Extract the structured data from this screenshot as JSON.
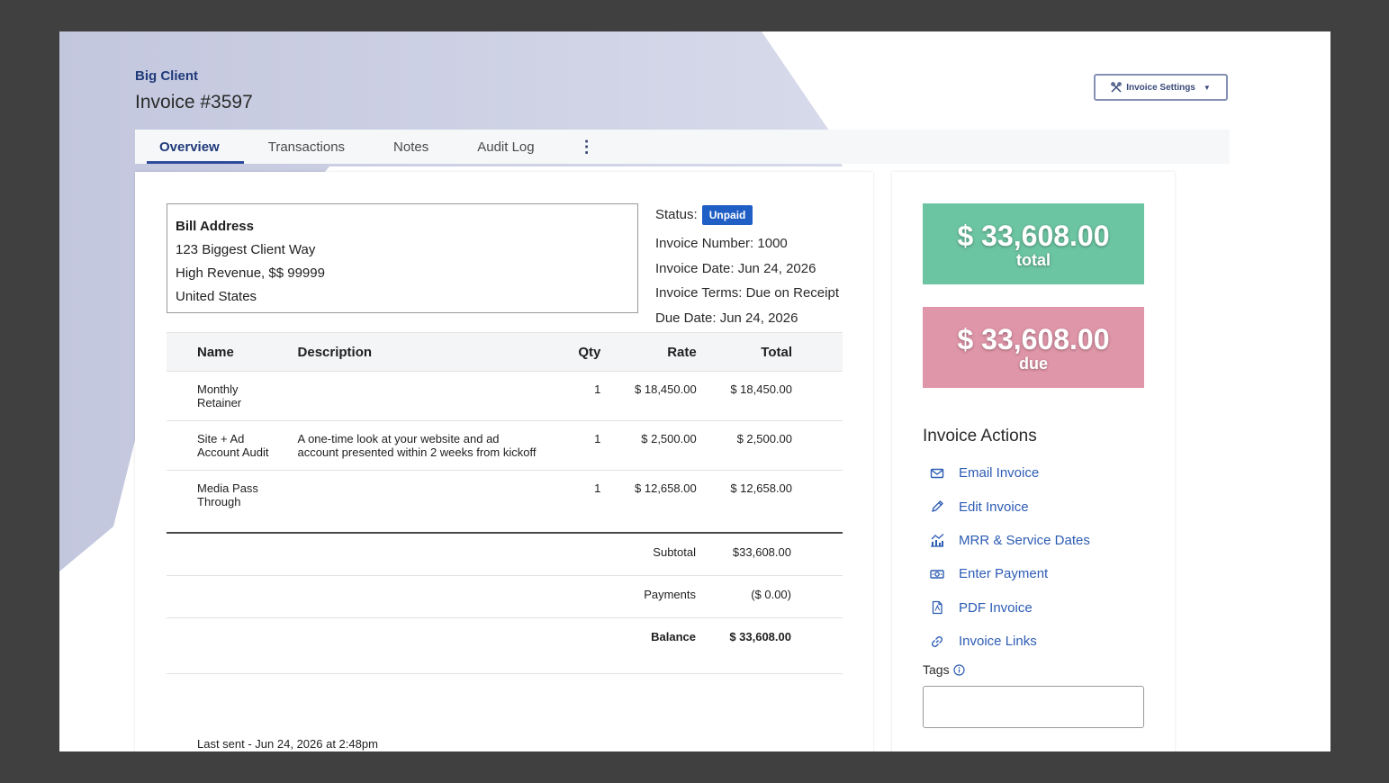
{
  "header": {
    "client_name": "Big Client",
    "invoice_title": "Invoice #3597",
    "settings_label": "Invoice Settings"
  },
  "tabs": [
    {
      "label": "Overview",
      "active": true
    },
    {
      "label": "Transactions"
    },
    {
      "label": "Notes"
    },
    {
      "label": "Audit Log"
    }
  ],
  "tabs_more": "⋮",
  "address": {
    "title": "Bill Address",
    "line1": "123 Biggest Client Way",
    "line2": "High Revenue, $$ 99999",
    "line3": "United States"
  },
  "status": {
    "label": "Status:",
    "badge": "Unpaid",
    "invoice_number": "Invoice Number: 1000",
    "invoice_date": "Invoice Date: Jun 24, 2026",
    "invoice_terms": "Invoice Terms: Due on Receipt",
    "due_date": "Due Date: Jun 24, 2026"
  },
  "table": {
    "headers": {
      "name": "Name",
      "description": "Description",
      "qty": "Qty",
      "rate": "Rate",
      "total": "Total"
    },
    "rows": [
      {
        "name_1": "Monthly",
        "name_2": "Retainer",
        "desc_1": "",
        "desc_2": "",
        "qty": "1",
        "rate": "$ 18,450.00",
        "total": "$ 18,450.00"
      },
      {
        "name_1": "Site + Ad",
        "name_2": "Account Audit",
        "desc_1": "A one-time look at your website and ad",
        "desc_2": "account presented within 2 weeks from kickoff",
        "qty": "1",
        "rate": "$ 2,500.00",
        "total": "$ 2,500.00"
      },
      {
        "name_1": "Media Pass",
        "name_2": "Through",
        "desc_1": "",
        "desc_2": "",
        "qty": "1",
        "rate": "$ 12,658.00",
        "total": "$ 12,658.00"
      }
    ]
  },
  "totals": {
    "subtotal_label": "Subtotal",
    "subtotal_value": "$33,608.00",
    "payments_label": "Payments",
    "payments_value": "($ 0.00)",
    "balance_label": "Balance",
    "balance_value": "$ 33,608.00"
  },
  "last_sent": "Last sent - Jun 24, 2026 at 2:48pm",
  "summary": {
    "total_amount": "$ 33,608.00",
    "total_label": "total",
    "due_amount": "$ 33,608.00",
    "due_label": "due"
  },
  "actions": {
    "title": "Invoice Actions",
    "items": [
      {
        "label": "Email Invoice",
        "icon": "envelope-icon"
      },
      {
        "label": "Edit Invoice",
        "icon": "pencil-icon"
      },
      {
        "label": "MRR & Service Dates",
        "icon": "chart-icon"
      },
      {
        "label": "Enter Payment",
        "icon": "money-icon"
      },
      {
        "label": "PDF Invoice",
        "icon": "pdf-file-icon"
      },
      {
        "label": "Invoice Links",
        "icon": "link-icon"
      }
    ]
  },
  "tags": {
    "label": "Tags",
    "value": ""
  },
  "colors": {
    "accent": "#2d5cb4",
    "total_card": "#6cc5a2",
    "due_card": "#e096a9",
    "badge": "#1f5ec4",
    "backdrop": "#404040"
  }
}
